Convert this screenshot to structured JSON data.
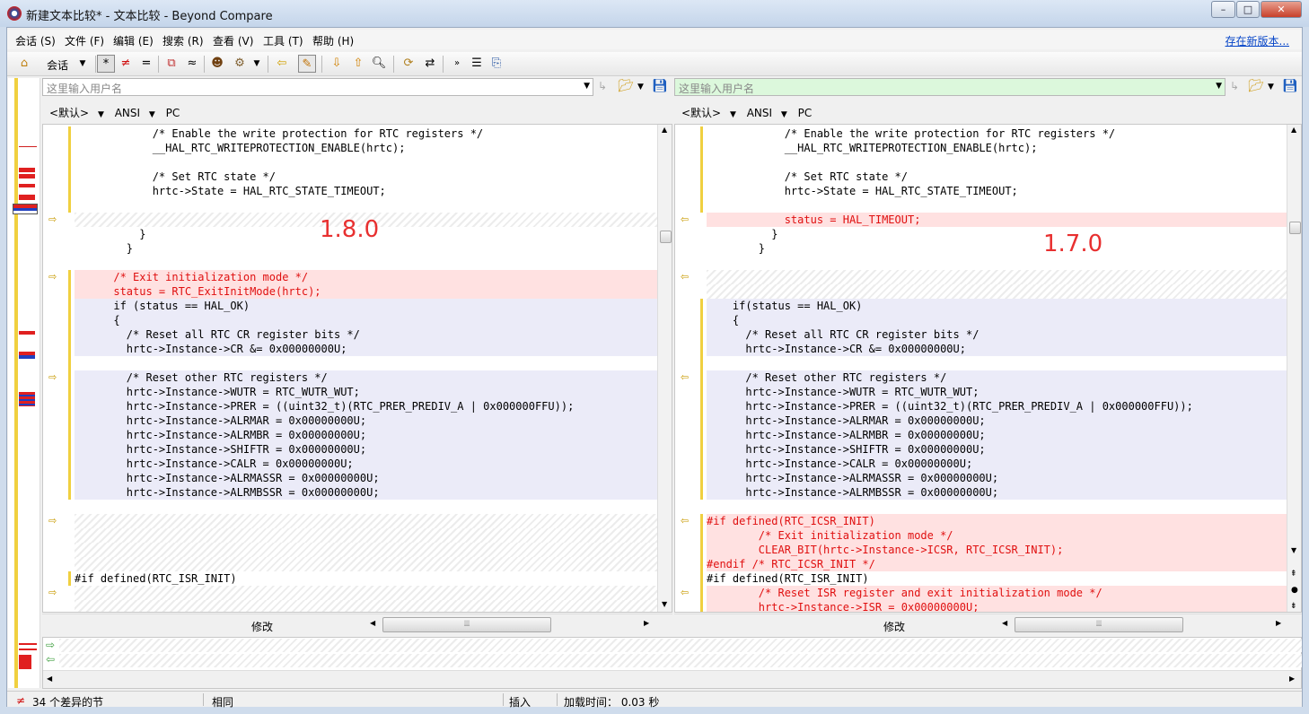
{
  "window": {
    "title": "新建文本比较* - 文本比较 - Beyond Compare",
    "controls": [
      "–",
      "□",
      "✕"
    ]
  },
  "menu": {
    "items": [
      "会话 (S)",
      "文件 (F)",
      "编辑 (E)",
      "搜索 (R)",
      "查看 (V)",
      "工具 (T)",
      "帮助 (H)"
    ],
    "save_new_version": "存在新版本..."
  },
  "toolbar": {
    "session_label": "会话",
    "icons": [
      "home-icon",
      "session-dropdown",
      "all-diff-toggle",
      "diffs-toggle",
      "same-toggle",
      "rules-icon",
      "similar-icon",
      "user-icon",
      "options-icon",
      "prev-file-icon",
      "edit-icon",
      "next-diff-icon",
      "prev-diff-icon",
      "find-icon",
      "refresh-icon",
      "swap-icon",
      "expand-icon",
      "list-icon",
      "export-icon"
    ]
  },
  "left": {
    "path_placeholder": "这里输入用户名",
    "format": {
      "profile": "<默认>",
      "encoding": "ANSI",
      "lineend": "PC"
    },
    "version_annotation": "1.8.0",
    "status_label": "修改",
    "lines": [
      {
        "text": "            /* Enable the write protection for RTC registers */",
        "kind": "normal"
      },
      {
        "text": "            __HAL_RTC_WRITEPROTECTION_ENABLE(hrtc);",
        "kind": "normal"
      },
      {
        "text": "",
        "kind": "normal"
      },
      {
        "text": "            /* Set RTC state */",
        "kind": "normal"
      },
      {
        "text": "            hrtc->State = HAL_RTC_STATE_TIMEOUT;",
        "kind": "normal"
      },
      {
        "text": "",
        "kind": "normal"
      },
      {
        "text": "",
        "kind": "hatch"
      },
      {
        "text": "          }",
        "kind": "normal"
      },
      {
        "text": "        }",
        "kind": "normal"
      },
      {
        "text": "",
        "kind": "normal"
      },
      {
        "text": "      /* Exit initialization mode */",
        "kind": "pink"
      },
      {
        "text": "      status = RTC_ExitInitMode(hrtc);",
        "kind": "pink"
      },
      {
        "text": "      if (status == HAL_OK)",
        "kind": "lav"
      },
      {
        "text": "      {",
        "kind": "lav"
      },
      {
        "text": "        /* Reset all RTC CR register bits */",
        "kind": "lav"
      },
      {
        "text": "        hrtc->Instance->CR &= 0x00000000U;",
        "kind": "lav"
      },
      {
        "text": "",
        "kind": "normal"
      },
      {
        "text": "        /* Reset other RTC registers */",
        "kind": "lav"
      },
      {
        "text": "        hrtc->Instance->WUTR = RTC_WUTR_WUT;",
        "kind": "lav"
      },
      {
        "text": "        hrtc->Instance->PRER = ((uint32_t)(RTC_PRER_PREDIV_A | 0x000000FFU));",
        "kind": "lav"
      },
      {
        "text": "        hrtc->Instance->ALRMAR = 0x00000000U;",
        "kind": "lav"
      },
      {
        "text": "        hrtc->Instance->ALRMBR = 0x00000000U;",
        "kind": "lav"
      },
      {
        "text": "        hrtc->Instance->SHIFTR = 0x00000000U;",
        "kind": "lav"
      },
      {
        "text": "        hrtc->Instance->CALR = 0x00000000U;",
        "kind": "lav"
      },
      {
        "text": "        hrtc->Instance->ALRMASSR = 0x00000000U;",
        "kind": "lav"
      },
      {
        "text": "        hrtc->Instance->ALRMBSSR = 0x00000000U;",
        "kind": "lav"
      },
      {
        "text": "",
        "kind": "normal"
      },
      {
        "text": "",
        "kind": "hatch"
      },
      {
        "text": "",
        "kind": "hatch"
      },
      {
        "text": "",
        "kind": "hatch"
      },
      {
        "text": "",
        "kind": "hatch"
      },
      {
        "text": "#if defined(RTC_ISR_INIT)",
        "kind": "normal"
      },
      {
        "text": "",
        "kind": "hatch"
      },
      {
        "text": "",
        "kind": "hatch"
      }
    ]
  },
  "right": {
    "path_placeholder": "这里输入用户名",
    "format": {
      "profile": "<默认>",
      "encoding": "ANSI",
      "lineend": "PC"
    },
    "version_annotation": "1.7.0",
    "status_label": "修改",
    "lines": [
      {
        "text": "            /* Enable the write protection for RTC registers */",
        "kind": "normal"
      },
      {
        "text": "            __HAL_RTC_WRITEPROTECTION_ENABLE(hrtc);",
        "kind": "normal"
      },
      {
        "text": "",
        "kind": "normal"
      },
      {
        "text": "            /* Set RTC state */",
        "kind": "normal"
      },
      {
        "text": "            hrtc->State = HAL_RTC_STATE_TIMEOUT;",
        "kind": "normal"
      },
      {
        "text": "",
        "kind": "normal"
      },
      {
        "text": "            status = HAL_TIMEOUT;",
        "kind": "pink"
      },
      {
        "text": "          }",
        "kind": "normal"
      },
      {
        "text": "        }",
        "kind": "normal"
      },
      {
        "text": "",
        "kind": "normal"
      },
      {
        "text": "",
        "kind": "hatch"
      },
      {
        "text": "",
        "kind": "hatch"
      },
      {
        "text": "    if(status == HAL_OK)",
        "kind": "lav"
      },
      {
        "text": "    {",
        "kind": "lav"
      },
      {
        "text": "      /* Reset all RTC CR register bits */",
        "kind": "lav"
      },
      {
        "text": "      hrtc->Instance->CR &= 0x00000000U;",
        "kind": "lav"
      },
      {
        "text": "",
        "kind": "normal"
      },
      {
        "text": "      /* Reset other RTC registers */",
        "kind": "lav"
      },
      {
        "text": "      hrtc->Instance->WUTR = RTC_WUTR_WUT;",
        "kind": "lav"
      },
      {
        "text": "      hrtc->Instance->PRER = ((uint32_t)(RTC_PRER_PREDIV_A | 0x000000FFU));",
        "kind": "lav"
      },
      {
        "text": "      hrtc->Instance->ALRMAR = 0x00000000U;",
        "kind": "lav"
      },
      {
        "text": "      hrtc->Instance->ALRMBR = 0x00000000U;",
        "kind": "lav"
      },
      {
        "text": "      hrtc->Instance->SHIFTR = 0x00000000U;",
        "kind": "lav"
      },
      {
        "text": "      hrtc->Instance->CALR = 0x00000000U;",
        "kind": "lav"
      },
      {
        "text": "      hrtc->Instance->ALRMASSR = 0x00000000U;",
        "kind": "lav"
      },
      {
        "text": "      hrtc->Instance->ALRMBSSR = 0x00000000U;",
        "kind": "lav"
      },
      {
        "text": "",
        "kind": "normal"
      },
      {
        "text": "#if defined(RTC_ICSR_INIT)",
        "kind": "pinkred"
      },
      {
        "text": "        /* Exit initialization mode */",
        "kind": "pinkred"
      },
      {
        "text": "        CLEAR_BIT(hrtc->Instance->ICSR, RTC_ICSR_INIT);",
        "kind": "pinkred"
      },
      {
        "text": "#endif /* RTC_ICSR_INIT */",
        "kind": "pinkred"
      },
      {
        "text": "#if defined(RTC_ISR_INIT)",
        "kind": "normal"
      },
      {
        "text": "        /* Reset ISR register and exit initialization mode */",
        "kind": "pinkred"
      },
      {
        "text": "        hrtc->Instance->ISR = 0x00000000U;",
        "kind": "pinkred"
      }
    ]
  },
  "arrow_rows": [
    6,
    10,
    17,
    27,
    32
  ],
  "status": {
    "diff_count": "34 个差异的节",
    "same": "相同",
    "insert": "插入",
    "load_time": "加载时间： 0.03 秒"
  },
  "colors": {
    "diff_red": "#e01010",
    "pink": "#ffe1e1",
    "lavender": "#ebebf8",
    "marker": "#f0d040"
  }
}
